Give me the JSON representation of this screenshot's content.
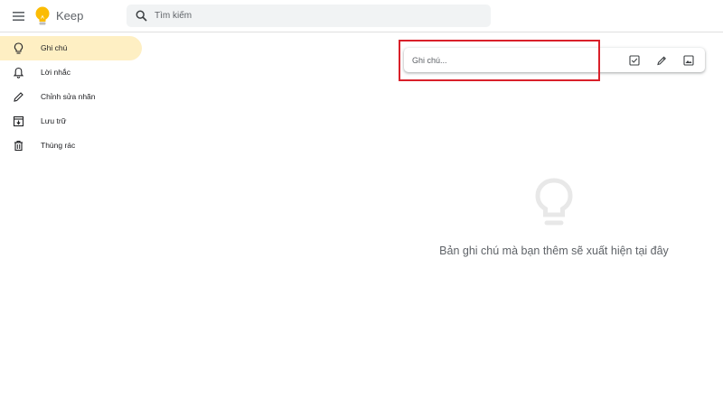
{
  "header": {
    "app_title": "Keep",
    "search_placeholder": "Tìm kiếm"
  },
  "sidebar": {
    "items": [
      {
        "label": "Ghi chú",
        "icon": "lightbulb-icon",
        "active": true
      },
      {
        "label": "Lời nhắc",
        "icon": "bell-icon",
        "active": false
      },
      {
        "label": "Chỉnh sửa nhãn",
        "icon": "pencil-icon",
        "active": false
      },
      {
        "label": "Lưu trữ",
        "icon": "archive-icon",
        "active": false
      },
      {
        "label": "Thùng rác",
        "icon": "trash-icon",
        "active": false
      }
    ]
  },
  "composer": {
    "placeholder": "Ghi chú...",
    "tools": [
      "checkbox-icon",
      "brush-icon",
      "image-icon"
    ]
  },
  "empty_state": {
    "icon": "lightbulb-icon",
    "message": "Bản ghi chú mà bạn thêm sẽ xuất hiện tại đây"
  },
  "colors": {
    "active_nav": "#feefc3",
    "highlight": "#d9202a",
    "logo_yellow": "#fbbc04",
    "search_bg": "#f1f3f4"
  }
}
